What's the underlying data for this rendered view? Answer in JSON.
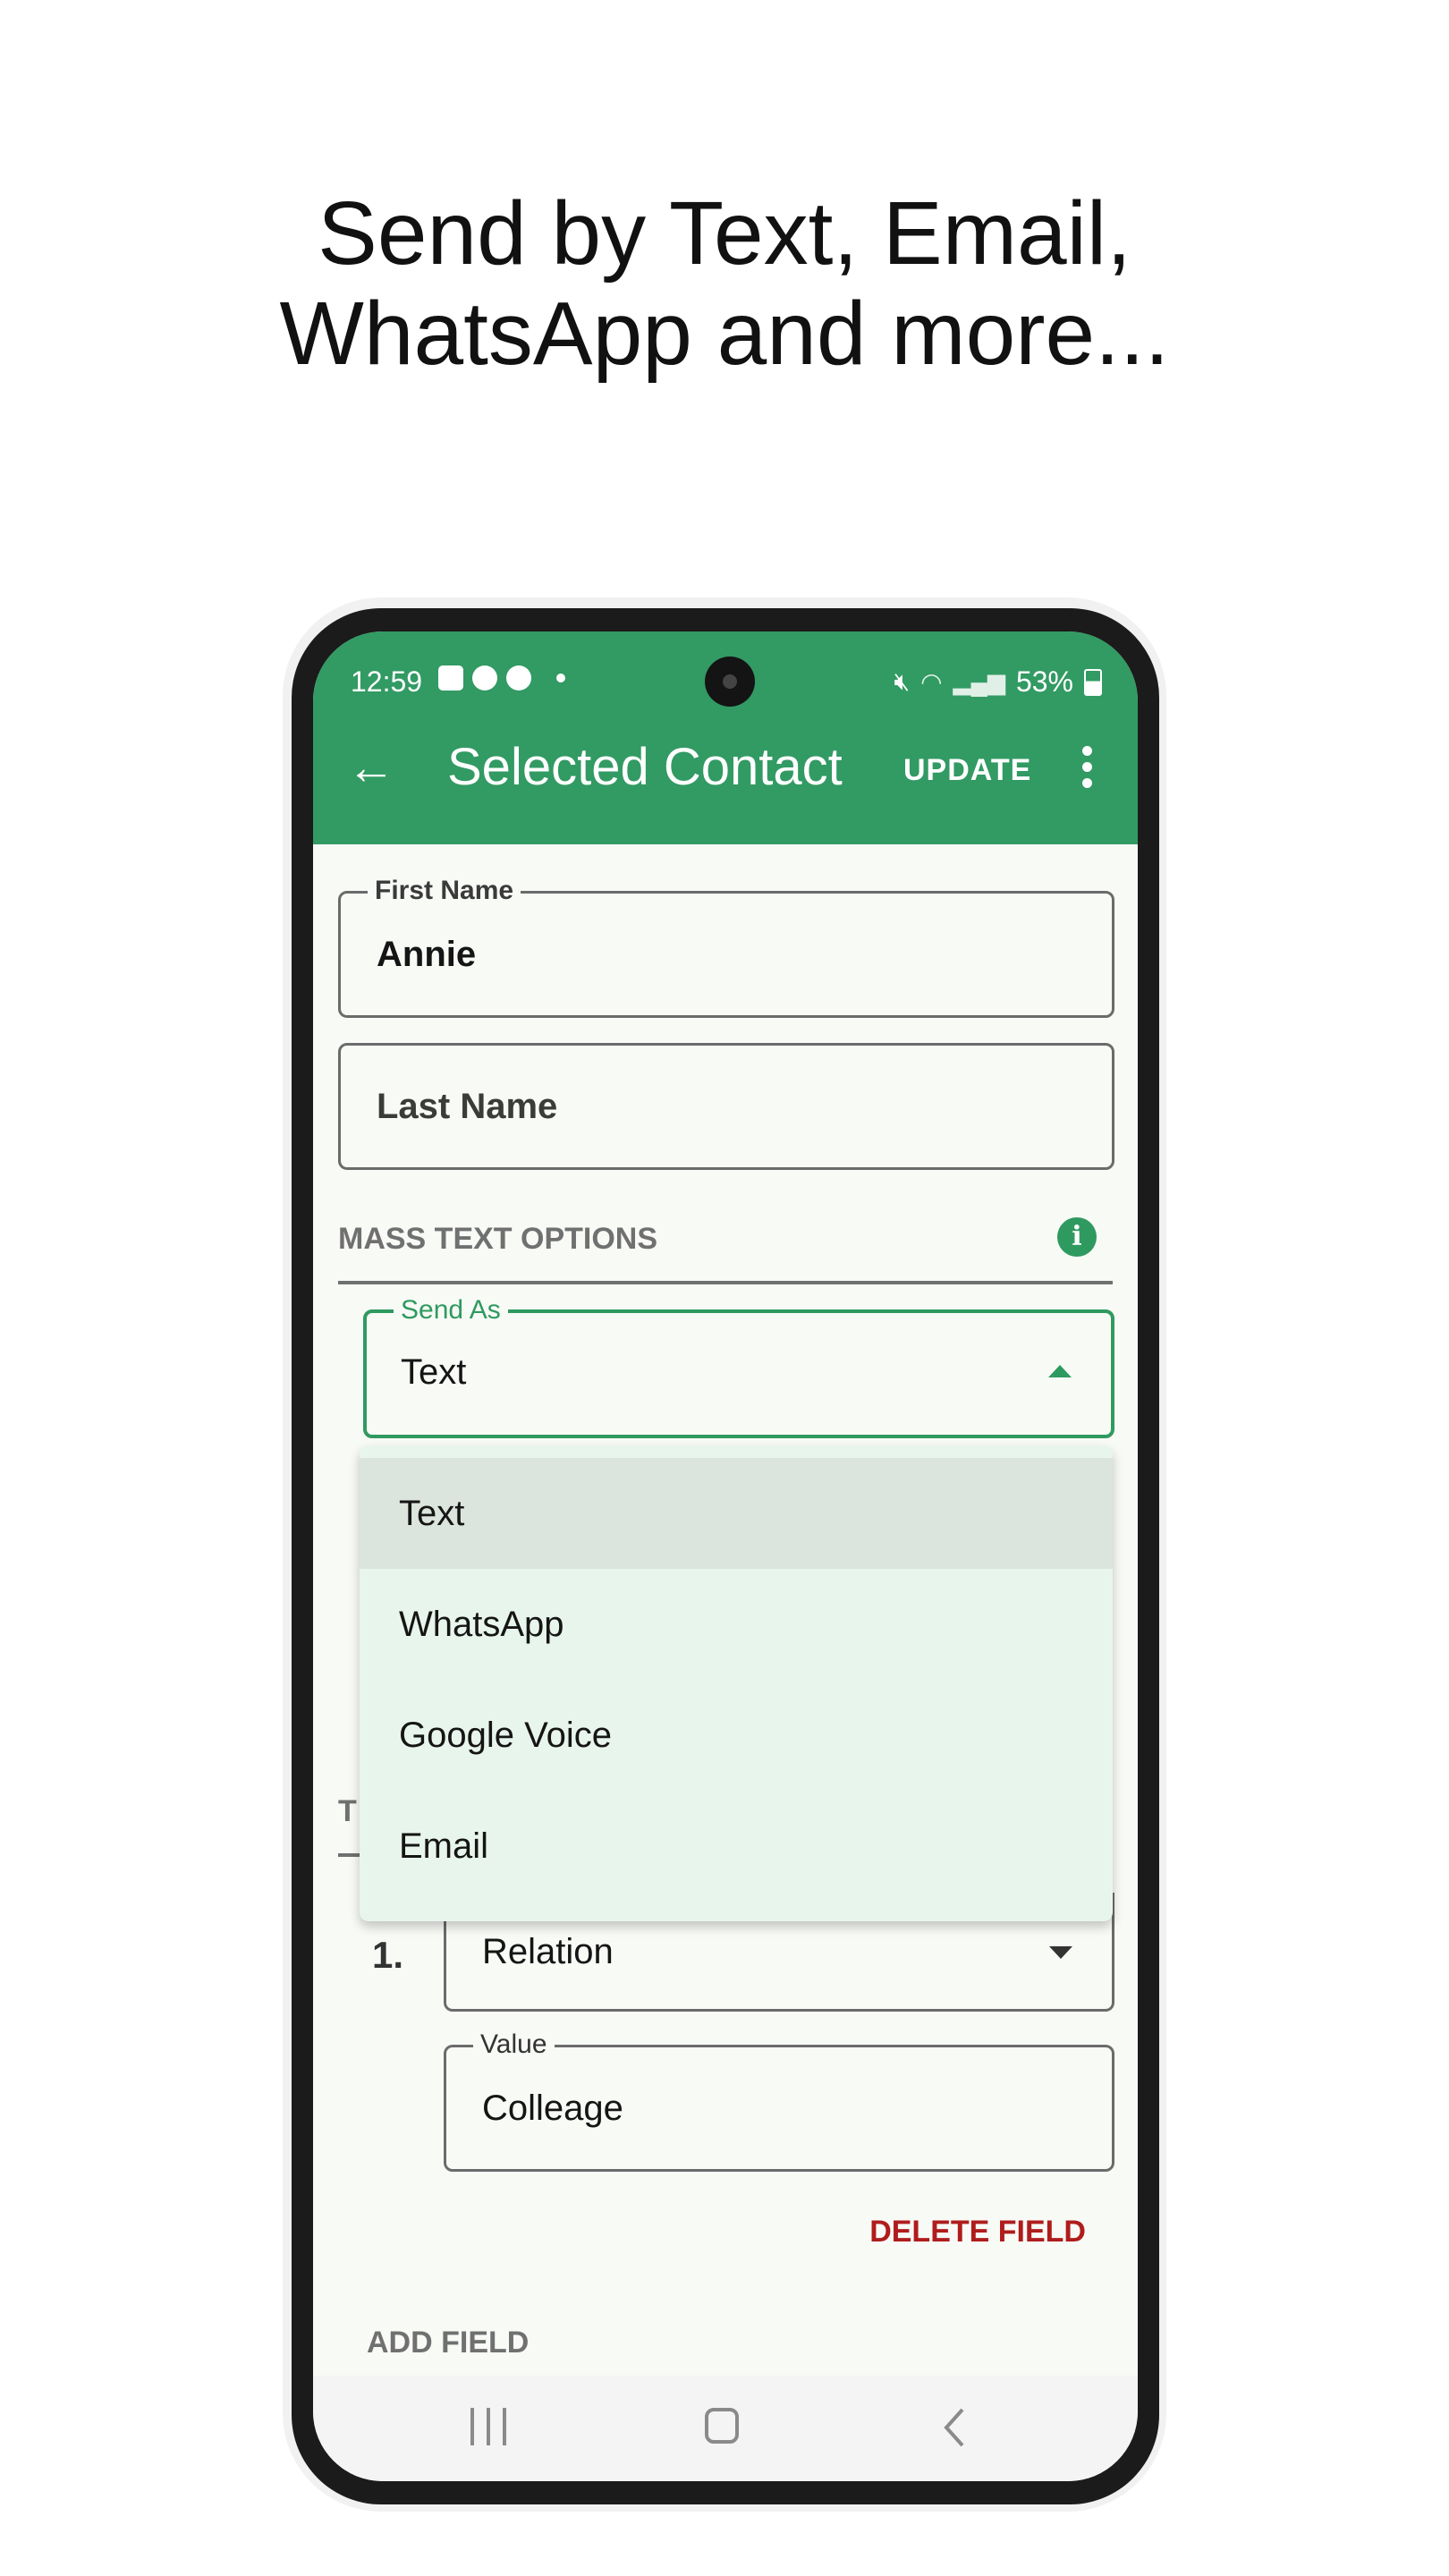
{
  "headline": {
    "line1": "Send by Text, Email,",
    "line2": "WhatsApp and more..."
  },
  "status_bar": {
    "time": "12:59",
    "left_icons": [
      "gallery-icon",
      "message-icon",
      "account-icon",
      "dot-icon"
    ],
    "right_icons": [
      "mute-icon",
      "wifi-icon",
      "signal-icon",
      "battery-icon"
    ],
    "battery": "53%"
  },
  "app_bar": {
    "back_icon": "arrow-left-icon",
    "title": "Selected Contact",
    "update_label": "UPDATE",
    "menu_icon": "more-vert-icon",
    "color": "#329a63"
  },
  "form": {
    "first_name": {
      "label": "First Name",
      "value": "Annie"
    },
    "last_name": {
      "placeholder": "Last Name",
      "value": ""
    },
    "mass_text_section": {
      "title": "MASS TEXT OPTIONS",
      "info_icon": "info-icon"
    },
    "send_as": {
      "label": "Send As",
      "value": "Text",
      "expanded": true,
      "options": [
        {
          "label": "Text",
          "selected": true
        },
        {
          "label": "WhatsApp",
          "selected": false
        },
        {
          "label": "Google Voice",
          "selected": false
        },
        {
          "label": "Email",
          "selected": false
        }
      ]
    },
    "partial_section_title": "T",
    "custom_fields": [
      {
        "index": "1.",
        "type": "Relation",
        "value_label": "Value",
        "value": "Colleage"
      }
    ],
    "delete_field_label": "DELETE FIELD",
    "add_field_label": "ADD FIELD"
  },
  "colors": {
    "accent": "#2f9a5f",
    "delete": "#b01c1c",
    "menu_bg": "#e8f5ec",
    "menu_selected": "#dbe5de"
  },
  "nav_bar": {
    "buttons": [
      "recents-icon",
      "home-icon",
      "back-icon"
    ]
  }
}
